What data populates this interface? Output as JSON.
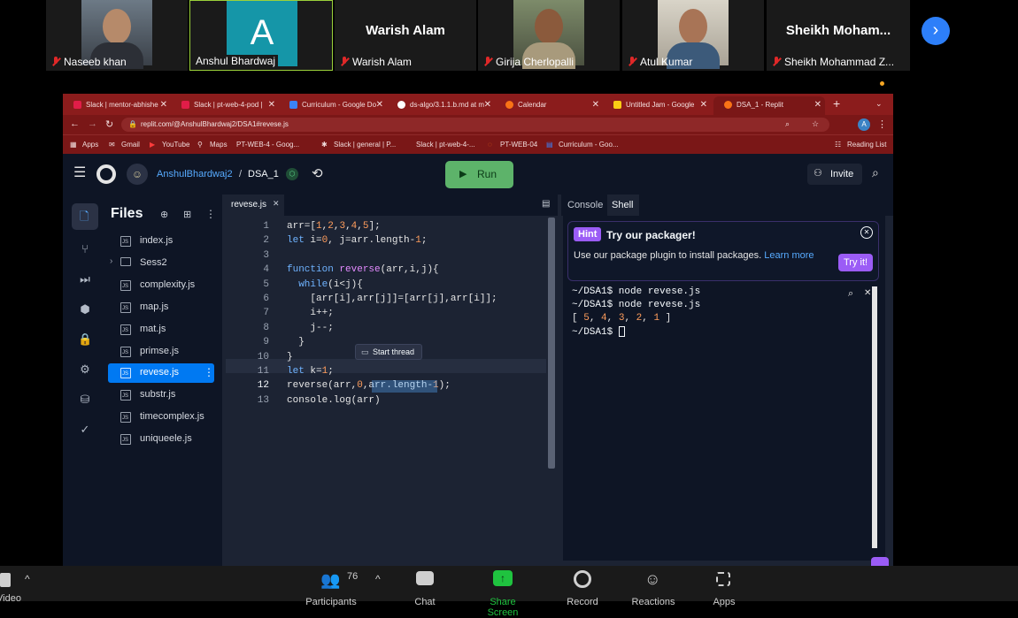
{
  "participants": [
    {
      "name": "Naseeb khan",
      "type": "photo"
    },
    {
      "name": "Anshul Bhardwaj",
      "type": "avatar",
      "initial": "A"
    },
    {
      "name": "Warish Alam",
      "type": "text",
      "display": "Warish Alam"
    },
    {
      "name": "Girija Cherlopalli",
      "type": "photo"
    },
    {
      "name": "Atul Kumar",
      "type": "photo"
    },
    {
      "name": "Sheikh Mohammad Z...",
      "type": "text",
      "display": "Sheikh  Moham..."
    }
  ],
  "browser": {
    "tabs": [
      {
        "label": "Slack | mentor-abhishe",
        "color": "#e11d48"
      },
      {
        "label": "Slack | pt-web-4-pod |",
        "color": "#e11d48"
      },
      {
        "label": "Curriculum - Google Do",
        "color": "#3b82f6"
      },
      {
        "label": "ds-algo/3.1.1.b.md at m",
        "color": "#ffffff"
      },
      {
        "label": "Calendar",
        "color": "#f97316"
      },
      {
        "label": "Untitled Jam - Google",
        "color": "#facc15"
      },
      {
        "label": "DSA_1 - Replit",
        "color": "#f97316"
      }
    ],
    "url": "replit.com/@AnshulBhardwaj2/DSA1#revese.js",
    "bookmarks": [
      "Apps",
      "Gmail",
      "YouTube",
      "Maps",
      "PT-WEB-4 - Goog...",
      "Slack | general | P...",
      "Slack | pt-web-4-...",
      "PT-WEB-04",
      "Curriculum - Goo..."
    ],
    "reading_list": "Reading List"
  },
  "replit": {
    "user": "AnshulBhardwaj2",
    "separator": "/",
    "repl": "DSA_1",
    "run_label": "Run",
    "invite_label": "Invite",
    "files_title": "Files",
    "files": [
      {
        "name": "index.js",
        "kind": "js"
      },
      {
        "name": "Sess2",
        "kind": "folder"
      },
      {
        "name": "complexity.js",
        "kind": "js"
      },
      {
        "name": "map.js",
        "kind": "js"
      },
      {
        "name": "mat.js",
        "kind": "js"
      },
      {
        "name": "primse.js",
        "kind": "js"
      },
      {
        "name": "revese.js",
        "kind": "js",
        "selected": true
      },
      {
        "name": "substr.js",
        "kind": "js"
      },
      {
        "name": "timecomplex.js",
        "kind": "js"
      },
      {
        "name": "uniqueele.js",
        "kind": "js"
      }
    ],
    "editor_tab": "revese.js",
    "code_lines": [
      "arr=[1,2,3,4,5];",
      "let i=0, j=arr.length-1;",
      "",
      "function reverse(arr,i,j){",
      "  while(i<j){",
      "    [arr[i],arr[j]]=[arr[j],arr[i]];",
      "    i++;",
      "    j--;",
      "  }",
      "}",
      "let k=1;",
      "reverse(arr,0,arr.length-1);",
      "console.log(arr)"
    ],
    "line_numbers": [
      "1",
      "2",
      "3",
      "4",
      "5",
      "6",
      "7",
      "8",
      "9",
      "10",
      "11",
      "12",
      "13"
    ],
    "tooltip": "Start thread",
    "right_tabs": [
      "Console",
      "Shell"
    ],
    "hint": {
      "badge": "Hint",
      "title": "Try our packager!",
      "body": "Use our package plugin to install packages.",
      "link": "Learn more",
      "button": "Try it!"
    },
    "terminal": [
      "~/DSA1$ node revese.js",
      "~/DSA1$ node revese.js",
      "[ 5, 4, 3, 2, 1 ]",
      "~/DSA1$ "
    ]
  },
  "meeting_bar": {
    "video_label": "Video",
    "participants_label": "Participants",
    "participants_count": "76",
    "chat_label": "Chat",
    "share_label": "Share Screen",
    "record_label": "Record",
    "reactions_label": "Reactions",
    "apps_label": "Apps"
  },
  "colors": {
    "chrome_tabbar": "#8b1c1c",
    "replit_bg": "#1c2333",
    "run_button": "#5db36a",
    "share_green": "#1fc33f",
    "hint_purple": "#9b5cf6"
  }
}
